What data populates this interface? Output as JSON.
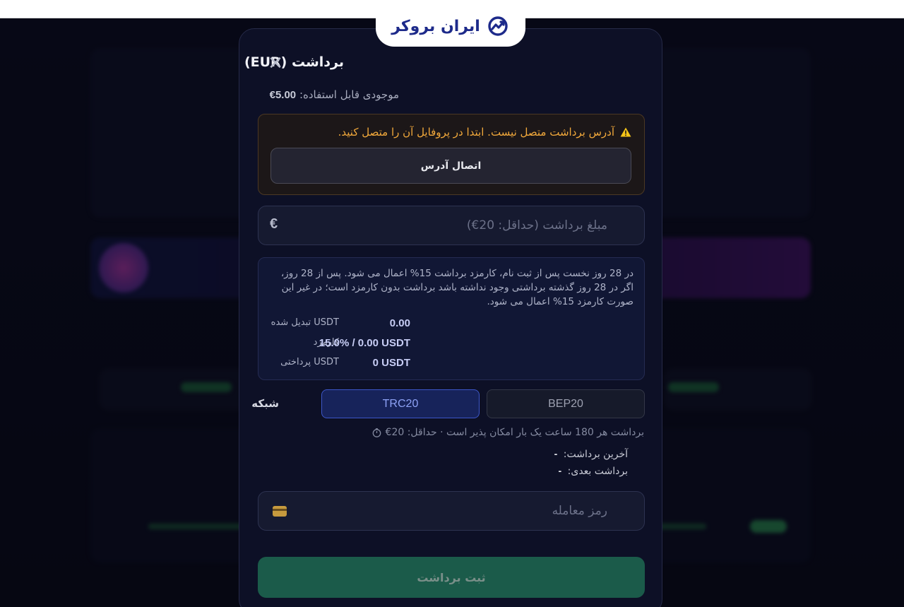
{
  "brand": {
    "name": "ایران بروکر"
  },
  "modal": {
    "title": "برداشت (EUR)",
    "balance_label": "موجودی قابل استفاده:",
    "balance_value": "5.00€",
    "alert": {
      "message": "آدرس برداشت متصل نیست. ابتدا در پروفایل آن را متصل کنید.",
      "button": "اتصال آدرس"
    },
    "amount": {
      "placeholder": "مبلغ برداشت (حداقل: 20€)",
      "currency": "€"
    },
    "fee_info": {
      "note": "در 28 روز نخست پس از ثبت نام، کارمزد برداشت 15% اعمال می شود. پس از 28 روز، اگر در 28 روز گذشته برداشتی وجود نداشته باشد برداشت بدون کارمزد است؛ در غیر این صورت کارمزد 15% اعمال می شود.",
      "rows": [
        {
          "label": "USDT تبدیل شده",
          "value": "0.00"
        },
        {
          "label": "کارمزد",
          "value": "15.0% / 0.00 USDT"
        },
        {
          "label": "USDT پرداختی",
          "value": "0 USDT"
        }
      ]
    },
    "network": {
      "label": "شبکه",
      "options": [
        "TRC20",
        "BEP20"
      ],
      "selected": "TRC20"
    },
    "limit_text": "برداشت هر 180 ساعت یک بار امکان پذیر است · حداقل: 20€",
    "last_withdrawal_label": "آخرین برداشت:",
    "last_withdrawal_value": "-",
    "next_withdrawal_label": "برداشت بعدی:",
    "next_withdrawal_value": "-",
    "password": {
      "placeholder": "رمز معامله"
    },
    "submit": "ثبت برداشت"
  },
  "icons": {
    "close": "close-icon",
    "warning": "warning-icon",
    "clock": "clock-icon",
    "card": "card-icon",
    "logo": "chart-up-logo-icon"
  },
  "colors": {
    "accent": "#3c56c8",
    "warning": "#f2a93b",
    "submit": "#1b5b4a"
  }
}
